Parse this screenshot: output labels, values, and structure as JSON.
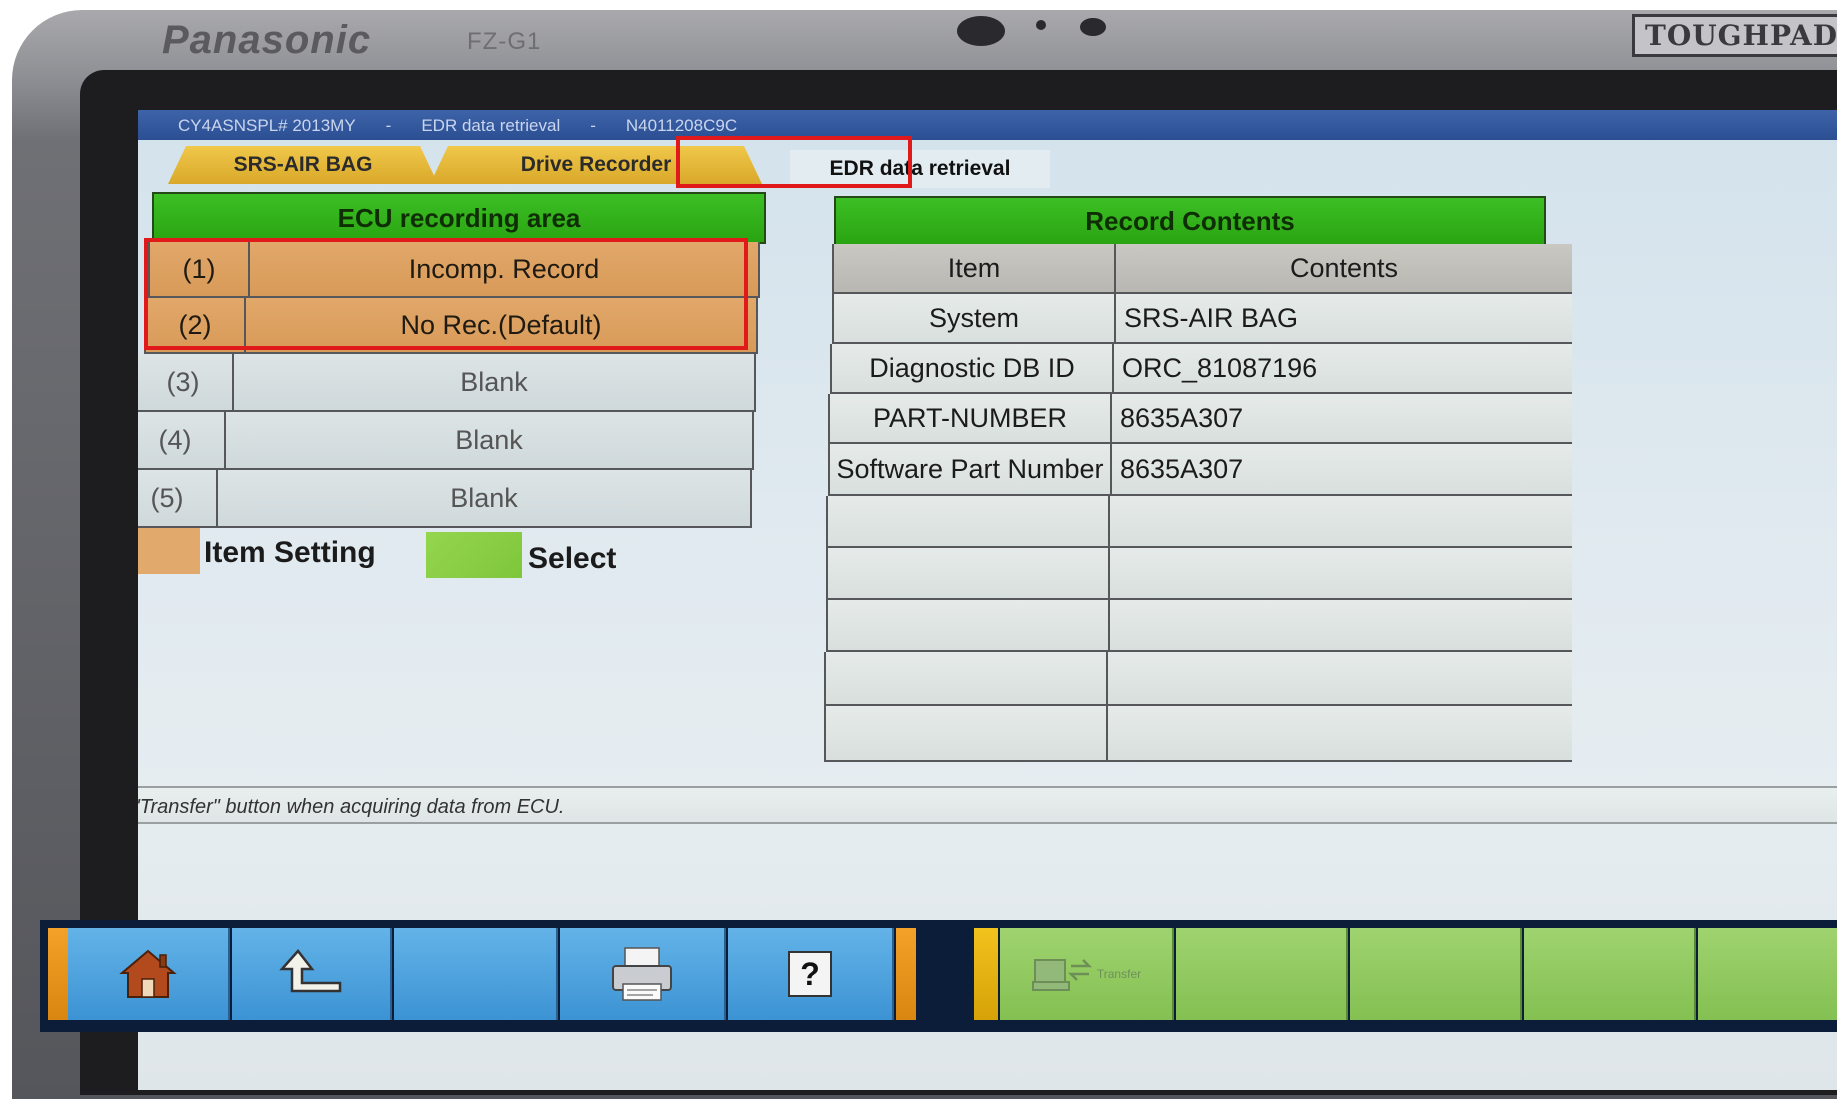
{
  "device": {
    "brand": "Panasonic",
    "model": "FZ-G1",
    "badge": "TOUGHPAD"
  },
  "titlebar": {
    "vehicle": "CY4ASNSPL# 2013MY",
    "separator1": "-",
    "function": "EDR data retrieval",
    "separator2": "-",
    "id": "N4011208C9C"
  },
  "tabs": [
    {
      "label": "SRS-AIR BAG"
    },
    {
      "label": "Drive Recorder"
    },
    {
      "label": "EDR data retrieval",
      "active": true
    }
  ],
  "ecu": {
    "header": "ECU recording area",
    "rows": [
      {
        "num": "(1)",
        "value": "Incomp. Record",
        "state": "item-setting"
      },
      {
        "num": "(2)",
        "value": "No Rec.(Default)",
        "state": "item-setting"
      },
      {
        "num": "(3)",
        "value": "Blank",
        "state": "blank"
      },
      {
        "num": "(4)",
        "value": "Blank",
        "state": "blank"
      },
      {
        "num": "(5)",
        "value": "Blank",
        "state": "blank"
      }
    ]
  },
  "legend": {
    "item_setting": {
      "label": "Item Setting",
      "color": "#e2a96c"
    },
    "select": {
      "label": "Select",
      "color": "#8fd24a"
    }
  },
  "record_contents": {
    "header": "Record Contents",
    "columns": [
      "Item",
      "Contents"
    ],
    "rows": [
      {
        "item": "System",
        "contents": "SRS-AIR BAG"
      },
      {
        "item": "Diagnostic DB ID",
        "contents": "ORC_81087196"
      },
      {
        "item": "PART-NUMBER",
        "contents": "8635A307"
      },
      {
        "item": "Software Part Number",
        "contents": "8635A307"
      },
      {
        "item": "",
        "contents": ""
      },
      {
        "item": "",
        "contents": ""
      },
      {
        "item": "",
        "contents": ""
      },
      {
        "item": "",
        "contents": ""
      },
      {
        "item": "",
        "contents": ""
      }
    ]
  },
  "status_message": "Press \"Transfer\" button when acquiring data from ECU.",
  "toolbar": {
    "buttons": [
      {
        "icon": "home-icon"
      },
      {
        "icon": "back-arrow-icon"
      },
      {
        "icon": ""
      },
      {
        "icon": "printer-icon"
      },
      {
        "icon": "help-icon",
        "glyph": "?"
      }
    ],
    "transfer_label": "Transfer",
    "colors": {
      "blue": "#4ea3de",
      "green": "#92ca60",
      "orange": "#f19a20",
      "yellow": "#f2c21d"
    }
  },
  "highlight_color": "#e01a1a"
}
